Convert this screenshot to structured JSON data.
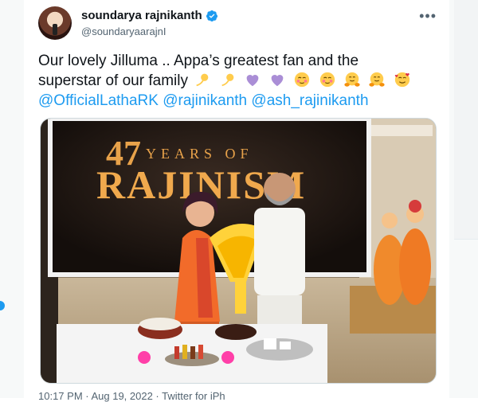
{
  "tweet": {
    "display_name": "soundarya rajnikanth",
    "handle": "@soundaryaarajnI",
    "text_line1": "Our lovely Jilluma .. Appa’s greatest fan and the",
    "text_line2": "superstar of our family",
    "mentions": [
      "@OfficialLathaRK",
      "@rajinikanth",
      "@ash_rajinikanth"
    ],
    "emojis": [
      "dizzy-icon",
      "dizzy-icon",
      "purple-heart-icon",
      "purple-heart-icon",
      "blush-face-icon",
      "blush-face-icon",
      "hugging-face-icon",
      "hugging-face-icon",
      "smiling-hearts-face-icon"
    ],
    "footer_partial": "10:17 PM · Aug 19, 2022 · Twitter for iPh"
  },
  "photo": {
    "banner_number": "47",
    "banner_years": "YEARS OF",
    "banner_title": "RAJINISM"
  },
  "colors": {
    "accent": "#1d9bf0",
    "text": "#0f1419",
    "muted": "#536471",
    "banner_gold": "#e8a24a",
    "saree_orange": "#f26b2a"
  }
}
